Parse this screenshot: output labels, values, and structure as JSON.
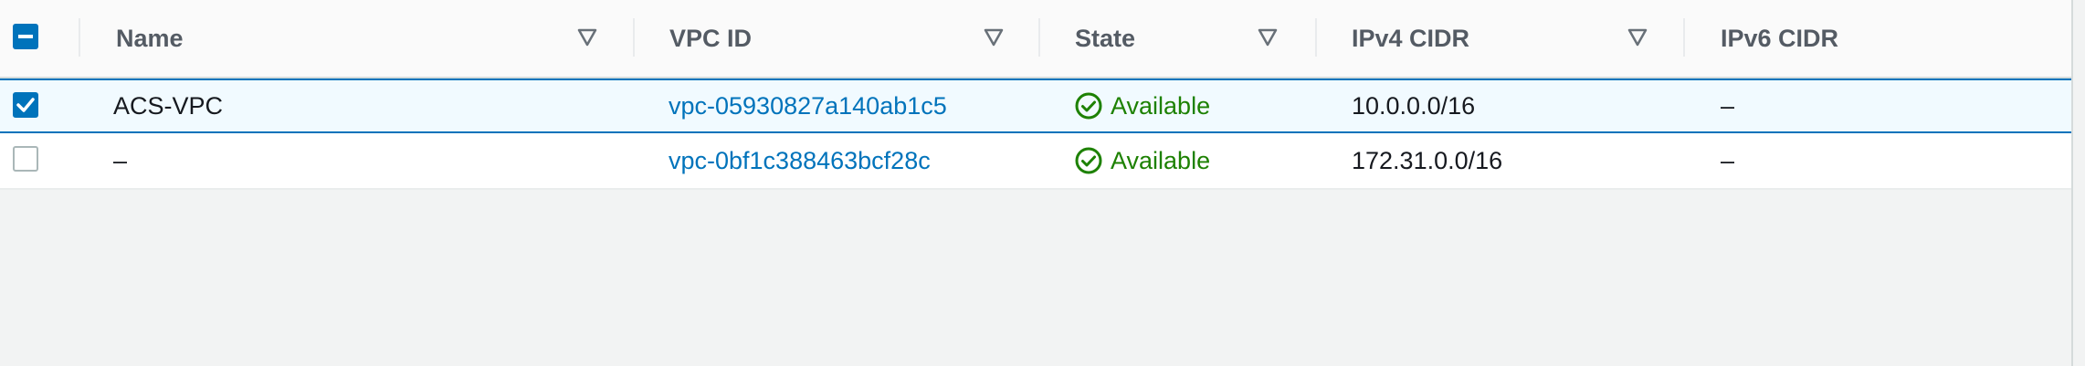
{
  "columns": {
    "name": "Name",
    "vpc_id": "VPC ID",
    "state": "State",
    "ipv4_cidr": "IPv4 CIDR",
    "ipv6_cidr": "IPv6 CIDR"
  },
  "rows": [
    {
      "selected": true,
      "name": "ACS-VPC",
      "vpc_id": "vpc-05930827a140ab1c5",
      "state": "Available",
      "ipv4_cidr": "10.0.0.0/16",
      "ipv6_cidr": "–"
    },
    {
      "selected": false,
      "name": "–",
      "vpc_id": "vpc-0bf1c388463bcf28c",
      "state": "Available",
      "ipv4_cidr": "172.31.0.0/16",
      "ipv6_cidr": "–"
    }
  ],
  "colors": {
    "accent": "#0073bb",
    "available": "#1d8102",
    "header_text": "#545b64"
  },
  "icons": {
    "select_all": "minus-square-icon",
    "sort": "sort-triangle-icon",
    "state": "check-circle-icon"
  }
}
